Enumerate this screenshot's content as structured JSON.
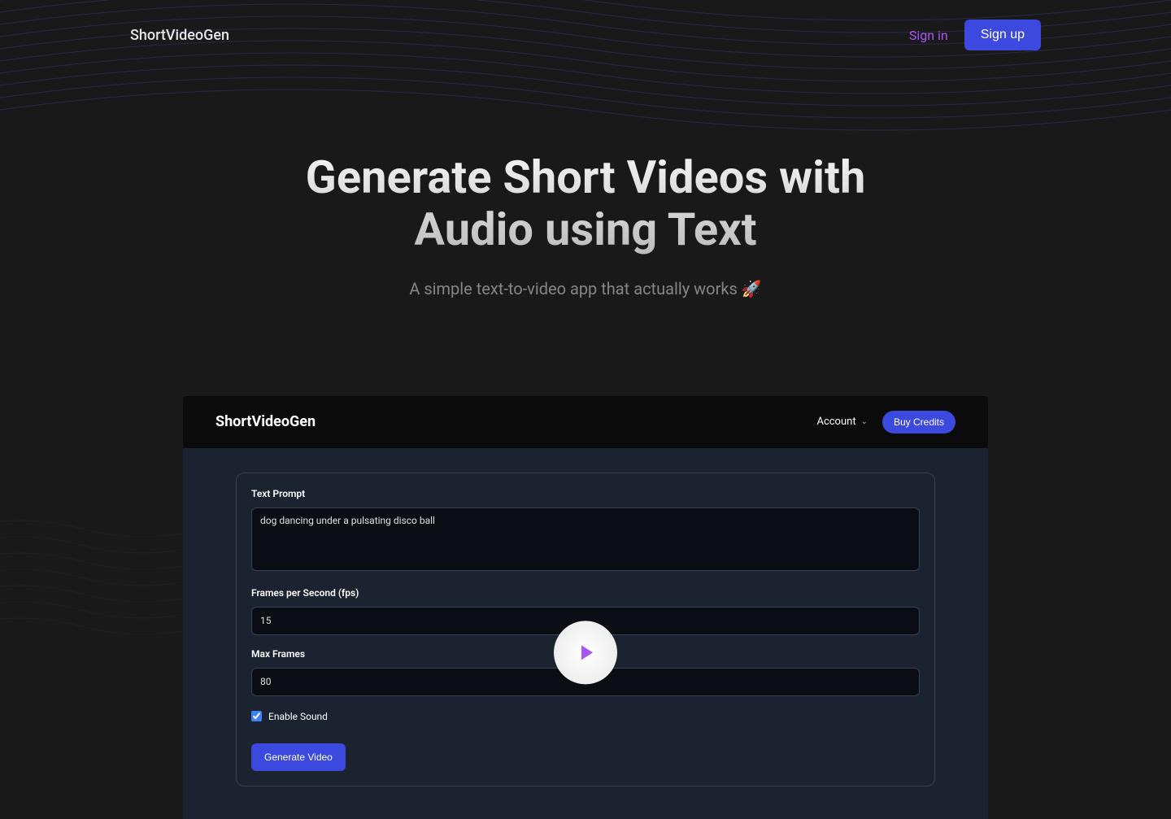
{
  "brand": "ShortVideoGen",
  "nav": {
    "signin": "Sign in",
    "signup": "Sign up"
  },
  "hero": {
    "title": "Generate Short Videos with Audio using Text",
    "subtitle": "A simple text-to-video app that actually works 🚀"
  },
  "demo": {
    "brand": "ShortVideoGen",
    "account_label": "Account",
    "buy_credits": "Buy Credits",
    "form": {
      "prompt_label": "Text Prompt",
      "prompt_value": "dog dancing under a pulsating disco ball",
      "fps_label": "Frames per Second (fps)",
      "fps_value": "15",
      "maxframes_label": "Max Frames",
      "maxframes_value": "80",
      "enable_sound_label": "Enable Sound",
      "enable_sound_checked": true,
      "generate_btn": "Generate Video"
    }
  },
  "colors": {
    "accent": "#3b49df",
    "purple": "#a855f7",
    "bg": "#191919"
  }
}
